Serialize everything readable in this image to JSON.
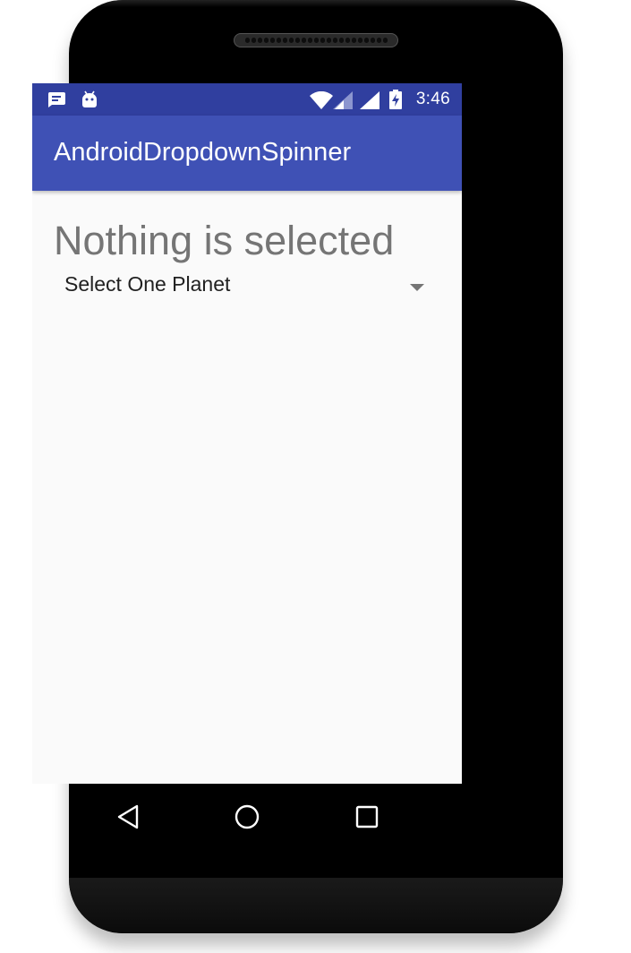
{
  "status_bar": {
    "time": "3:46",
    "left_icons": [
      "message-notification-icon",
      "android-debug-icon"
    ],
    "right_icons": [
      "wifi-signal-icon",
      "cell-signal-icon",
      "battery-charging-icon"
    ]
  },
  "app_bar": {
    "title": "AndroidDropdownSpinner"
  },
  "main": {
    "status_text": "Nothing is selected",
    "spinner": {
      "selected_value": "Select One Planet"
    }
  },
  "nav_bar": {
    "buttons": [
      "back-icon",
      "home-icon",
      "recents-icon"
    ]
  },
  "colors": {
    "status_bar": "#303f9f",
    "app_bar": "#3f51b5",
    "background": "#fafafa",
    "status_text": "#757575"
  }
}
